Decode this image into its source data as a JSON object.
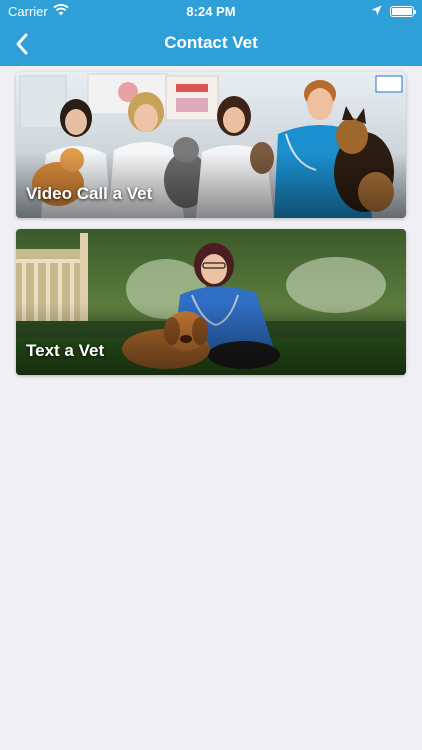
{
  "status_bar": {
    "carrier": "Carrier",
    "time": "8:24 PM",
    "icons": [
      "wifi-icon",
      "location-arrow-icon",
      "battery-icon"
    ]
  },
  "nav": {
    "title": "Contact Vet",
    "back_icon": "chevron-left-icon"
  },
  "cards": [
    {
      "label": "Video Call a Vet"
    },
    {
      "label": "Text a Vet"
    }
  ],
  "colors": {
    "header": "#2f9fd8",
    "background": "#efeff4",
    "label_text": "#ffffff"
  }
}
